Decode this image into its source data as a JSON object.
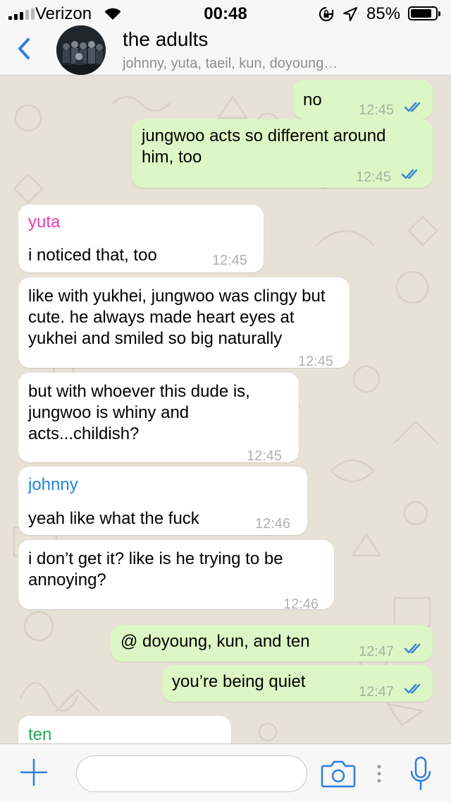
{
  "status_bar": {
    "carrier": "Verizon",
    "time": "00:48",
    "battery": "85%",
    "battery_level": 0.85,
    "signal_icon": "signal-bars-icon",
    "wifi_icon": "wifi-icon",
    "rotation_lock_icon": "rotation-lock-icon",
    "location_icon": "location-arrow-icon"
  },
  "header": {
    "back_icon": "chevron-left-icon",
    "title": "the adults",
    "members": "johnny, yuta, taeil, kun, doyoung…",
    "accent": "#2b7fe0"
  },
  "messages": [
    {
      "dir": "out",
      "text": "no",
      "time": "12:45",
      "read": true
    },
    {
      "dir": "out",
      "text": "jungwoo acts so different around him, too",
      "time": "12:45",
      "read": true
    },
    {
      "dir": "in",
      "sender": "yuta",
      "sender_color": "#e83cae",
      "text": "i noticed that, too",
      "time": "12:45"
    },
    {
      "dir": "in",
      "text": "like with yukhei, jungwoo was clingy but cute. he always made heart eyes at yukhei and smiled so big naturally",
      "time": "12:45"
    },
    {
      "dir": "in",
      "text": "but with whoever this dude is, jungwoo is whiny and acts...childish?",
      "time": "12:45"
    },
    {
      "dir": "in",
      "sender": "johnny",
      "sender_color": "#1e85d8",
      "text": "yeah like what the fuck",
      "time": "12:46"
    },
    {
      "dir": "in",
      "text": "i don’t get it? like is he trying to be annoying?",
      "time": "12:46"
    },
    {
      "dir": "out",
      "text": "@ doyoung, kun, and ten",
      "time": "12:47",
      "read": true
    },
    {
      "dir": "out",
      "text": "you’re being quiet",
      "time": "12:47",
      "read": true
    },
    {
      "dir": "in",
      "sender": "ten",
      "sender_color": "#27a55b",
      "text": ""
    }
  ],
  "colors": {
    "outgoing_bubble": "#dcf7c5",
    "incoming_bubble": "#ffffff",
    "read_ticks": "#3b86d6",
    "wallpaper": "#e8e1d6"
  },
  "input_bar": {
    "attach_icon": "plus-icon",
    "message_placeholder": "",
    "camera_icon": "camera-icon",
    "mic_icon": "microphone-icon"
  }
}
